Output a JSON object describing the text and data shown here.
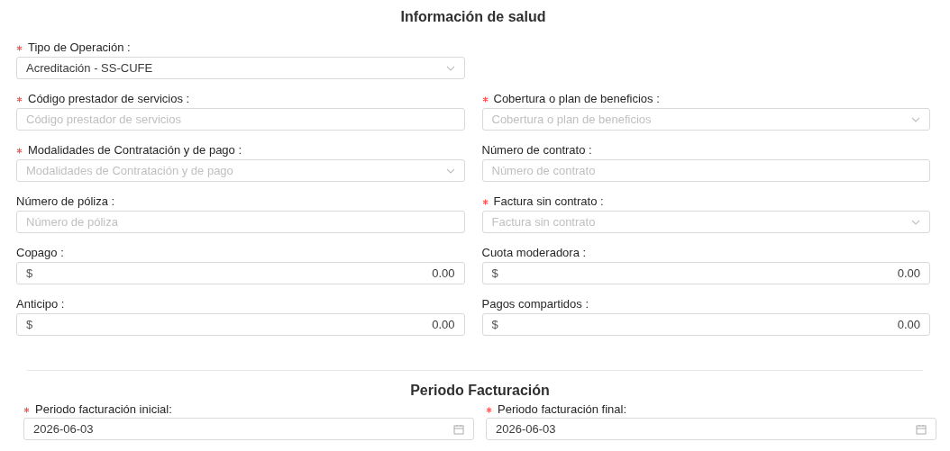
{
  "health_section": {
    "title": "Información de salud",
    "rows": [
      {
        "fields": [
          {
            "kind": "select",
            "label": "Tipo de Operación :",
            "required": true,
            "value": "Acreditación - SS-CUFE"
          }
        ]
      },
      {
        "fields": [
          {
            "kind": "text",
            "label": "Código prestador de servicios :",
            "required": true,
            "placeholder": "Código prestador de servicios"
          },
          {
            "kind": "select",
            "label": "Cobertura o plan de beneficios :",
            "required": true,
            "placeholder": "Cobertura o plan de beneficios"
          }
        ]
      },
      {
        "fields": [
          {
            "kind": "select",
            "label": "Modalidades de Contratación y de pago :",
            "required": true,
            "placeholder": "Modalidades de Contratación y de pago"
          },
          {
            "kind": "text",
            "label": "Número de contrato :",
            "required": false,
            "placeholder": "Número de contrato"
          }
        ]
      },
      {
        "fields": [
          {
            "kind": "text",
            "label": "Número de póliza :",
            "required": false,
            "placeholder": "Número de póliza"
          },
          {
            "kind": "select",
            "label": "Factura sin contrato :",
            "required": true,
            "placeholder": "Factura sin contrato"
          }
        ]
      },
      {
        "fields": [
          {
            "kind": "money",
            "label": "Copago :",
            "required": false,
            "prefix": "$",
            "value": "0.00"
          },
          {
            "kind": "money",
            "label": "Cuota moderadora :",
            "required": false,
            "prefix": "$",
            "value": "0.00"
          }
        ]
      },
      {
        "fields": [
          {
            "kind": "money",
            "label": "Anticipo :",
            "required": false,
            "prefix": "$",
            "value": "0.00"
          },
          {
            "kind": "money",
            "label": "Pagos compartidos :",
            "required": false,
            "prefix": "$",
            "value": "0.00"
          }
        ]
      }
    ]
  },
  "billing_period": {
    "title": "Periodo Facturación",
    "fields": [
      {
        "kind": "date",
        "label": "Periodo facturación inicial:",
        "required": true,
        "value": "2026-06-03"
      },
      {
        "kind": "date",
        "label": "Periodo facturación final:",
        "required": true,
        "value": "2026-06-03"
      }
    ]
  }
}
